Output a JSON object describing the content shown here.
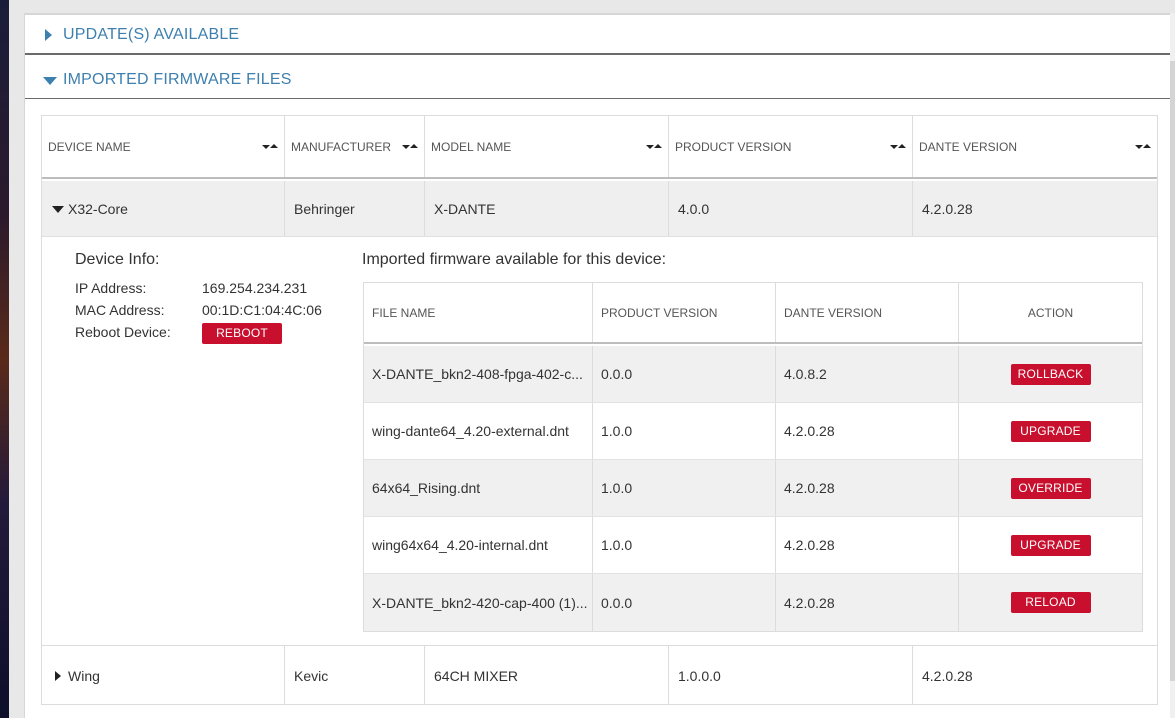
{
  "sections": {
    "updates": {
      "label": "UPDATE(S) AVAILABLE"
    },
    "imported": {
      "label": "IMPORTED FIRMWARE FILES"
    }
  },
  "main_table": {
    "headers": [
      "DEVICE NAME",
      "MANUFACTURER",
      "MODEL NAME",
      "PRODUCT VERSION",
      "DANTE VERSION"
    ],
    "rows": [
      {
        "device": "X32-Core",
        "manufacturer": "Behringer",
        "model": "X-DANTE",
        "product_version": "4.0.0",
        "dante_version": "4.2.0.28",
        "expanded": true
      },
      {
        "device": "Wing",
        "manufacturer": "Kevic",
        "model": "64CH MIXER",
        "product_version": "1.0.0.0",
        "dante_version": "4.2.0.28",
        "expanded": false
      }
    ]
  },
  "device_info": {
    "title": "Device Info:",
    "ip_label": "IP Address:",
    "ip_value": "169.254.234.231",
    "mac_label": "MAC Address:",
    "mac_value": "00:1D:C1:04:4C:06",
    "reboot_label": "Reboot Device:",
    "reboot_button": "REBOOT"
  },
  "firmware": {
    "title": "Imported firmware available for this device:",
    "headers": [
      "FILE NAME",
      "PRODUCT VERSION",
      "DANTE VERSION",
      "ACTION"
    ],
    "rows": [
      {
        "file": "X-DANTE_bkn2-408-fpga-402-c...",
        "product_version": "0.0.0",
        "dante_version": "4.0.8.2",
        "action": "ROLLBACK"
      },
      {
        "file": "wing-dante64_4.20-external.dnt",
        "product_version": "1.0.0",
        "dante_version": "4.2.0.28",
        "action": "UPGRADE"
      },
      {
        "file": "64x64_Rising.dnt",
        "product_version": "1.0.0",
        "dante_version": "4.2.0.28",
        "action": "OVERRIDE"
      },
      {
        "file": "wing64x64_4.20-internal.dnt",
        "product_version": "1.0.0",
        "dante_version": "4.2.0.28",
        "action": "UPGRADE"
      },
      {
        "file": "X-DANTE_bkn2-420-cap-400 (1)...",
        "product_version": "0.0.0",
        "dante_version": "4.2.0.28",
        "action": "RELOAD"
      }
    ]
  },
  "colors": {
    "accent": "#3d7fae",
    "action_button": "#c8102e",
    "row_alt": "#f0f0f0"
  },
  "icons": [
    "caret-right-icon",
    "caret-down-icon",
    "sort-icon"
  ]
}
